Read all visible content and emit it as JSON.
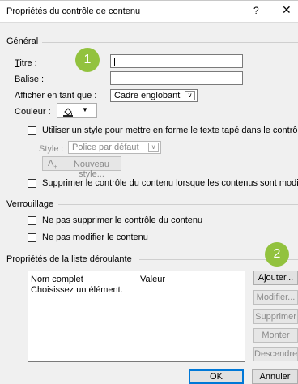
{
  "window": {
    "title": "Propriétés du contrôle de contenu",
    "help_glyph": "?",
    "close_glyph": "✕"
  },
  "badges": [
    "1",
    "2"
  ],
  "general": {
    "section_title": "Général",
    "title_label": "Titre :",
    "tag_label": "Balise :",
    "display_label": "Afficher en tant que :",
    "display_value": "Cadre englobant",
    "color_label": "Couleur :",
    "use_style_label": "Utiliser un style pour mettre en forme le texte tapé dans le contrôle vide",
    "style_label": "Style :",
    "style_value": "Police par défaut",
    "new_style_button": "Nouveau style...",
    "remove_when_edited_label": "Supprimer le contrôle du contenu lorsque les contenus sont modifiés"
  },
  "locking": {
    "section_title": "Verrouillage",
    "no_delete_label": "Ne pas supprimer le contrôle du contenu",
    "no_edit_label": "Ne pas modifier le contenu"
  },
  "dropdown": {
    "section_title": "Propriétés de la liste déroulante",
    "col_name": "Nom complet",
    "col_value": "Valeur",
    "rows": [
      {
        "name": "Choisissez un élément.",
        "value": ""
      }
    ],
    "buttons": {
      "add": "Ajouter...",
      "modify": "Modifier...",
      "delete": "Supprimer",
      "up": "Monter",
      "down": "Descendre"
    }
  },
  "footer": {
    "ok": "OK",
    "cancel": "Annuler"
  },
  "colors": {
    "badge": "#92c23e",
    "primary_border": "#0078d7"
  }
}
